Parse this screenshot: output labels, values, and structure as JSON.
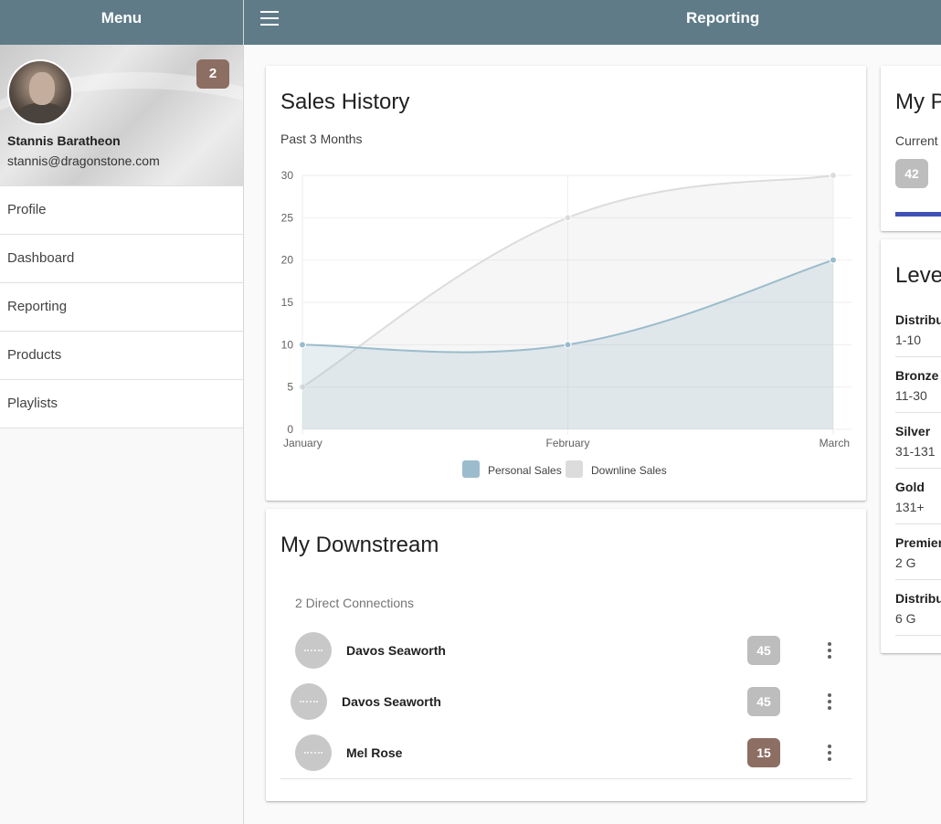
{
  "sidebar": {
    "title": "Menu",
    "profile": {
      "name": "Stannis Baratheon",
      "email": "stannis@dragonstone.com",
      "notifications": "2"
    },
    "items": [
      {
        "label": "Profile"
      },
      {
        "label": "Dashboard"
      },
      {
        "label": "Reporting"
      },
      {
        "label": "Products"
      },
      {
        "label": "Playlists"
      }
    ]
  },
  "topbar": {
    "title": "Reporting",
    "menu_icon": "hamburger-icon"
  },
  "sales_history": {
    "title": "Sales History",
    "subtitle": "Past 3 Months",
    "chart_data": {
      "type": "area",
      "categories": [
        "January",
        "February",
        "March"
      ],
      "series": [
        {
          "name": "Personal Sales",
          "values": [
            10,
            10,
            20
          ],
          "color": "#9bbccc"
        },
        {
          "name": "Downline Sales",
          "values": [
            5,
            25,
            30
          ],
          "color": "#dcdcdc"
        }
      ],
      "ylim": [
        0,
        30
      ],
      "yticks": [
        0,
        5,
        10,
        15,
        20,
        25,
        30
      ],
      "grid": true,
      "legend": "bottom"
    }
  },
  "downstream": {
    "title": "My Downstream",
    "subtitle": "2 Direct Connections",
    "rows": [
      {
        "name": "Davos Seaworth",
        "count": "45"
      },
      {
        "name": "Davos Seaworth",
        "count": "45"
      },
      {
        "name": "Mel Rose",
        "count": "15"
      }
    ]
  },
  "points": {
    "title": "My P",
    "current_label": "Current",
    "value": "42"
  },
  "levels": {
    "title": "Leve",
    "items": [
      {
        "name": "Distribu",
        "range": "1-10"
      },
      {
        "name": "Bronze",
        "range": "11-30"
      },
      {
        "name": "Silver",
        "range": "31-131"
      },
      {
        "name": "Gold",
        "range": "131+"
      },
      {
        "name": "Premier",
        "range": "2 G"
      },
      {
        "name": "Distribu",
        "range": "6 G"
      }
    ]
  }
}
